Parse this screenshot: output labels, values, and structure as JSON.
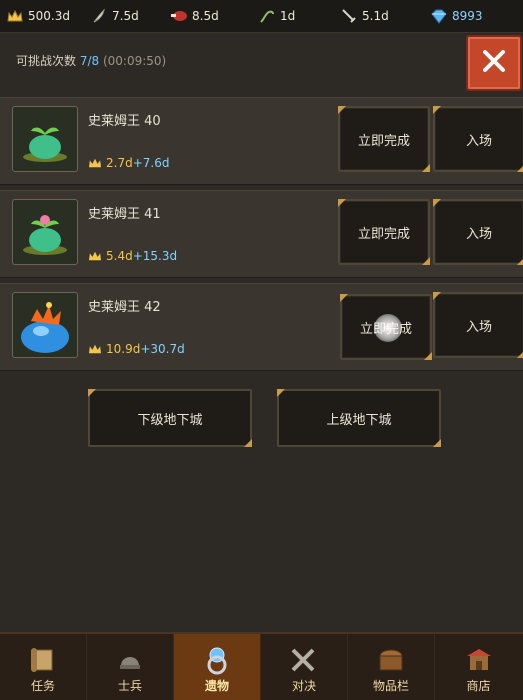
{
  "resources": [
    {
      "icon": "crown-icon",
      "value": "500.3d"
    },
    {
      "icon": "feather-icon",
      "value": "7.5d"
    },
    {
      "icon": "meat-icon",
      "value": "8.5d"
    },
    {
      "icon": "vine-icon",
      "value": "1d"
    },
    {
      "icon": "sword-icon",
      "value": "5.1d"
    },
    {
      "icon": "diamond-icon",
      "value": "8993"
    }
  ],
  "header": {
    "label": "可挑战次数",
    "count": "7/8",
    "timer": "(00:09:50)"
  },
  "dungeons": [
    {
      "name": "史莱姆王 40",
      "reward": "2.7d",
      "bonus": "+7.6d",
      "done_label": "立即完成",
      "enter_label": "入场"
    },
    {
      "name": "史莱姆王 41",
      "reward": "5.4d",
      "bonus": "+15.3d",
      "done_label": "立即完成",
      "enter_label": "入场"
    },
    {
      "name": "史莱姆王 42",
      "reward": "10.9d",
      "bonus": "+30.7d",
      "done_label": "立即完成",
      "enter_label": "入场"
    }
  ],
  "nav": {
    "down_label": "下级地下城",
    "up_label": "上级地下城"
  },
  "tabs": [
    {
      "label": "任务",
      "icon": "scroll-icon"
    },
    {
      "label": "士兵",
      "icon": "helmet-icon"
    },
    {
      "label": "遗物",
      "icon": "relic-icon"
    },
    {
      "label": "对决",
      "icon": "crossed-swords-icon"
    },
    {
      "label": "物品栏",
      "icon": "chest-icon"
    },
    {
      "label": "商店",
      "icon": "shop-icon"
    }
  ],
  "active_tab": "遗物"
}
